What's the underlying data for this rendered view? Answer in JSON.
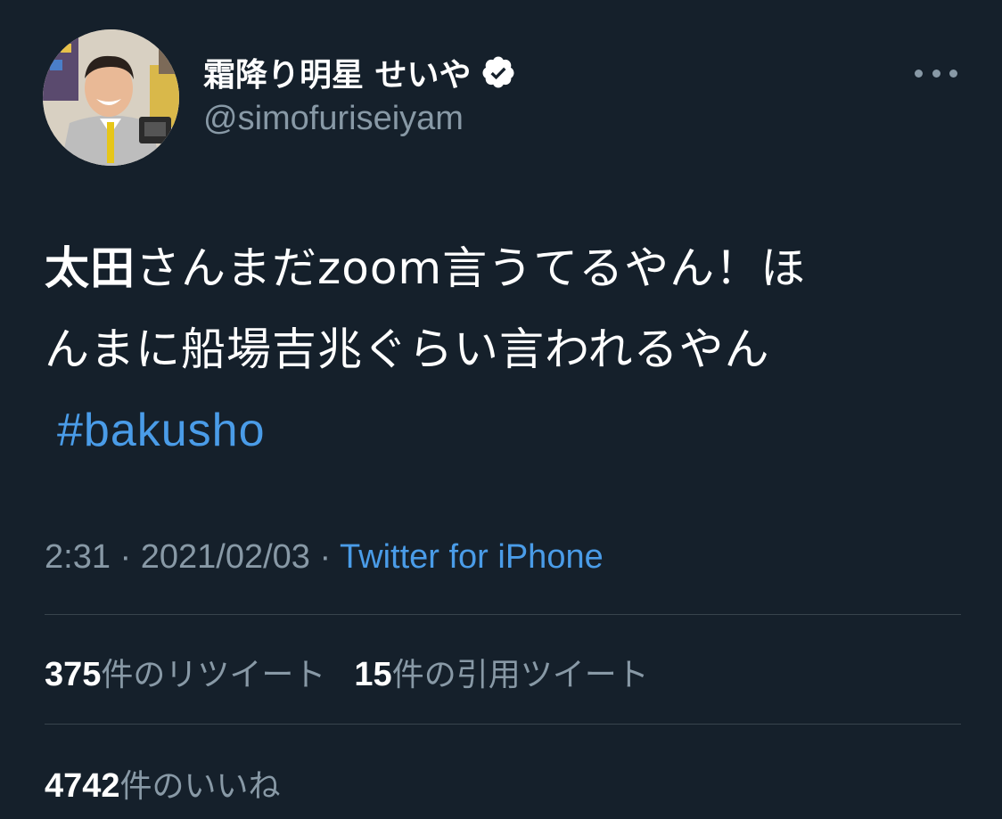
{
  "author": {
    "display_name": "霜降り明星 せいや",
    "handle": "@simofuriseiyam",
    "verified": true
  },
  "tweet": {
    "text_line1_bold": "太田",
    "text_line1_rest": "さんまだzoom言うてるやん！ほ",
    "text_line2": "んまに船場吉兆ぐらい言われるやん",
    "hashtag": "#bakusho"
  },
  "meta": {
    "time": "2:31",
    "separator": " · ",
    "date": "2021/02/03",
    "source": "Twitter for iPhone"
  },
  "stats": {
    "retweets_count": "375",
    "retweets_label": "件のリツイート",
    "quotes_count": "15",
    "quotes_label": "件の引用ツイート",
    "likes_count": "4742",
    "likes_label": "件のいいね"
  },
  "colors": {
    "background": "#15202b",
    "secondary_text": "#8899a6",
    "link": "#4a9ce8",
    "divider": "#38444d"
  },
  "icons": {
    "verified": "verified-badge-icon",
    "more": "more-options-icon"
  }
}
